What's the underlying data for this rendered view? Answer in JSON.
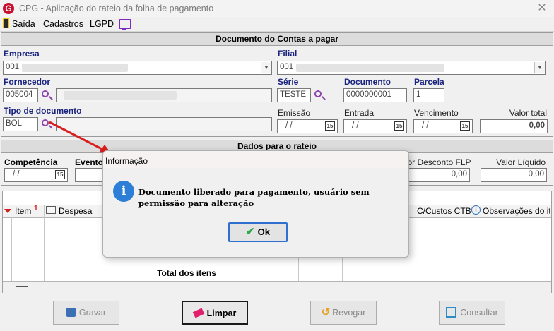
{
  "window": {
    "title": "CPG - Aplicação do rateio da folha de pagamento",
    "close_glyph": "✕"
  },
  "menu": {
    "items": [
      "Saída",
      "Cadastros",
      "LGPD"
    ]
  },
  "doc_panel": {
    "header": "Documento do Contas a pagar",
    "empresa_label": "Empresa",
    "empresa_value": "001",
    "filial_label": "Filial",
    "filial_value": "001",
    "fornecedor_label": "Fornecedor",
    "fornecedor_value": "005004",
    "serie_label": "Série",
    "serie_value": "TESTE",
    "documento_label": "Documento",
    "documento_value": "0000000001",
    "parcela_label": "Parcela",
    "parcela_value": "1",
    "tipo_doc_label": "Tipo de documento",
    "tipo_doc_value": "BOL",
    "emissao_label": "Emissão",
    "emissao_value": "/ /",
    "entrada_label": "Entrada",
    "entrada_value": "/ /",
    "vencimento_label": "Vencimento",
    "vencimento_value": "/ /",
    "valor_total_label": "Valor total",
    "valor_total_value": "0,00",
    "calendar_glyph": "15"
  },
  "rateio_panel": {
    "header": "Dados para o rateio",
    "competencia_label": "Competência",
    "competencia_value": "/ /",
    "evento_label": "Evento",
    "valor_desconto_label": "Valor Desconto FLP",
    "valor_desconto_value": "0,00",
    "valor_liquido_label": "Valor Líquido",
    "valor_liquido_value": "0,00"
  },
  "grid": {
    "col_item": "Item",
    "item_sort_number": "1",
    "col_despesa": "Despesa",
    "col_ccustos": "C/Custos CTB",
    "col_obs": "Observações do iten",
    "total_label": "Total dos itens"
  },
  "buttons": {
    "gravar": "Gravar",
    "limpar": "Limpar",
    "revogar": "Revogar",
    "consultar": "Consultar"
  },
  "dialog": {
    "title": "Informação",
    "message": "Documento liberado para pagamento, usuário sem permissão para alteração",
    "ok_label": "Ok",
    "info_glyph": "i"
  },
  "colors": {
    "accent_blue": "#2d7ed6",
    "label_blue": "#1a237e",
    "arrow_red": "#d81e1e",
    "logo_red": "#c8102e"
  }
}
